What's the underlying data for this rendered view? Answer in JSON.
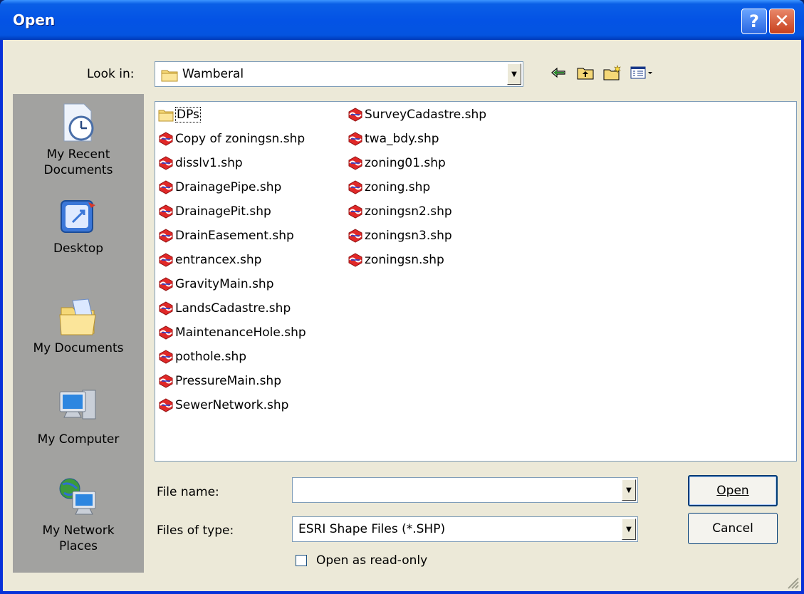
{
  "window": {
    "title": "Open",
    "help_label": "?",
    "close_label": "✕"
  },
  "lookin": {
    "label": "Look in:",
    "value": "Wamberal"
  },
  "toolbar": {
    "icons": [
      "back-arrow-icon",
      "up-folder-icon",
      "new-folder-icon",
      "view-menu-icon"
    ]
  },
  "places": [
    {
      "label_line1": "My Recent",
      "label_line2": "Documents",
      "icon": "recent-documents-icon"
    },
    {
      "label_line1": "Desktop",
      "label_line2": "",
      "icon": "desktop-icon"
    },
    {
      "label_line1": "My Documents",
      "label_line2": "",
      "icon": "my-documents-icon"
    },
    {
      "label_line1": "My Computer",
      "label_line2": "",
      "icon": "my-computer-icon"
    },
    {
      "label_line1": "My Network",
      "label_line2": "Places",
      "icon": "network-places-icon"
    }
  ],
  "files_col1": [
    {
      "name": "DPs",
      "type": "folder"
    },
    {
      "name": "Copy of zoningsn.shp",
      "type": "shp"
    },
    {
      "name": "disslv1.shp",
      "type": "shp"
    },
    {
      "name": "DrainagePipe.shp",
      "type": "shp"
    },
    {
      "name": "DrainagePit.shp",
      "type": "shp"
    },
    {
      "name": "DrainEasement.shp",
      "type": "shp"
    },
    {
      "name": "entrancex.shp",
      "type": "shp"
    },
    {
      "name": "GravityMain.shp",
      "type": "shp"
    },
    {
      "name": "LandsCadastre.shp",
      "type": "shp"
    },
    {
      "name": "MaintenanceHole.shp",
      "type": "shp"
    },
    {
      "name": "pothole.shp",
      "type": "shp"
    },
    {
      "name": "PressureMain.shp",
      "type": "shp"
    },
    {
      "name": "SewerNetwork.shp",
      "type": "shp"
    }
  ],
  "files_col2": [
    {
      "name": "SurveyCadastre.shp",
      "type": "shp"
    },
    {
      "name": "twa_bdy.shp",
      "type": "shp"
    },
    {
      "name": "zoning01.shp",
      "type": "shp"
    },
    {
      "name": "zoning.shp",
      "type": "shp"
    },
    {
      "name": "zoningsn2.shp",
      "type": "shp"
    },
    {
      "name": "zoningsn3.shp",
      "type": "shp"
    },
    {
      "name": "zoningsn.shp",
      "type": "shp"
    }
  ],
  "filename": {
    "label": "File name:",
    "value": ""
  },
  "filetype": {
    "label": "Files of type:",
    "value": "ESRI Shape Files (*.SHP)"
  },
  "readonly": {
    "label": "Open as read-only",
    "checked": false
  },
  "buttons": {
    "open": "Open",
    "cancel": "Cancel"
  },
  "colors": {
    "titlebar": "#0454e0",
    "dialog_bg": "#ece9d8",
    "places_bg": "#a2a2a0",
    "shp_icon": "#d82020"
  }
}
